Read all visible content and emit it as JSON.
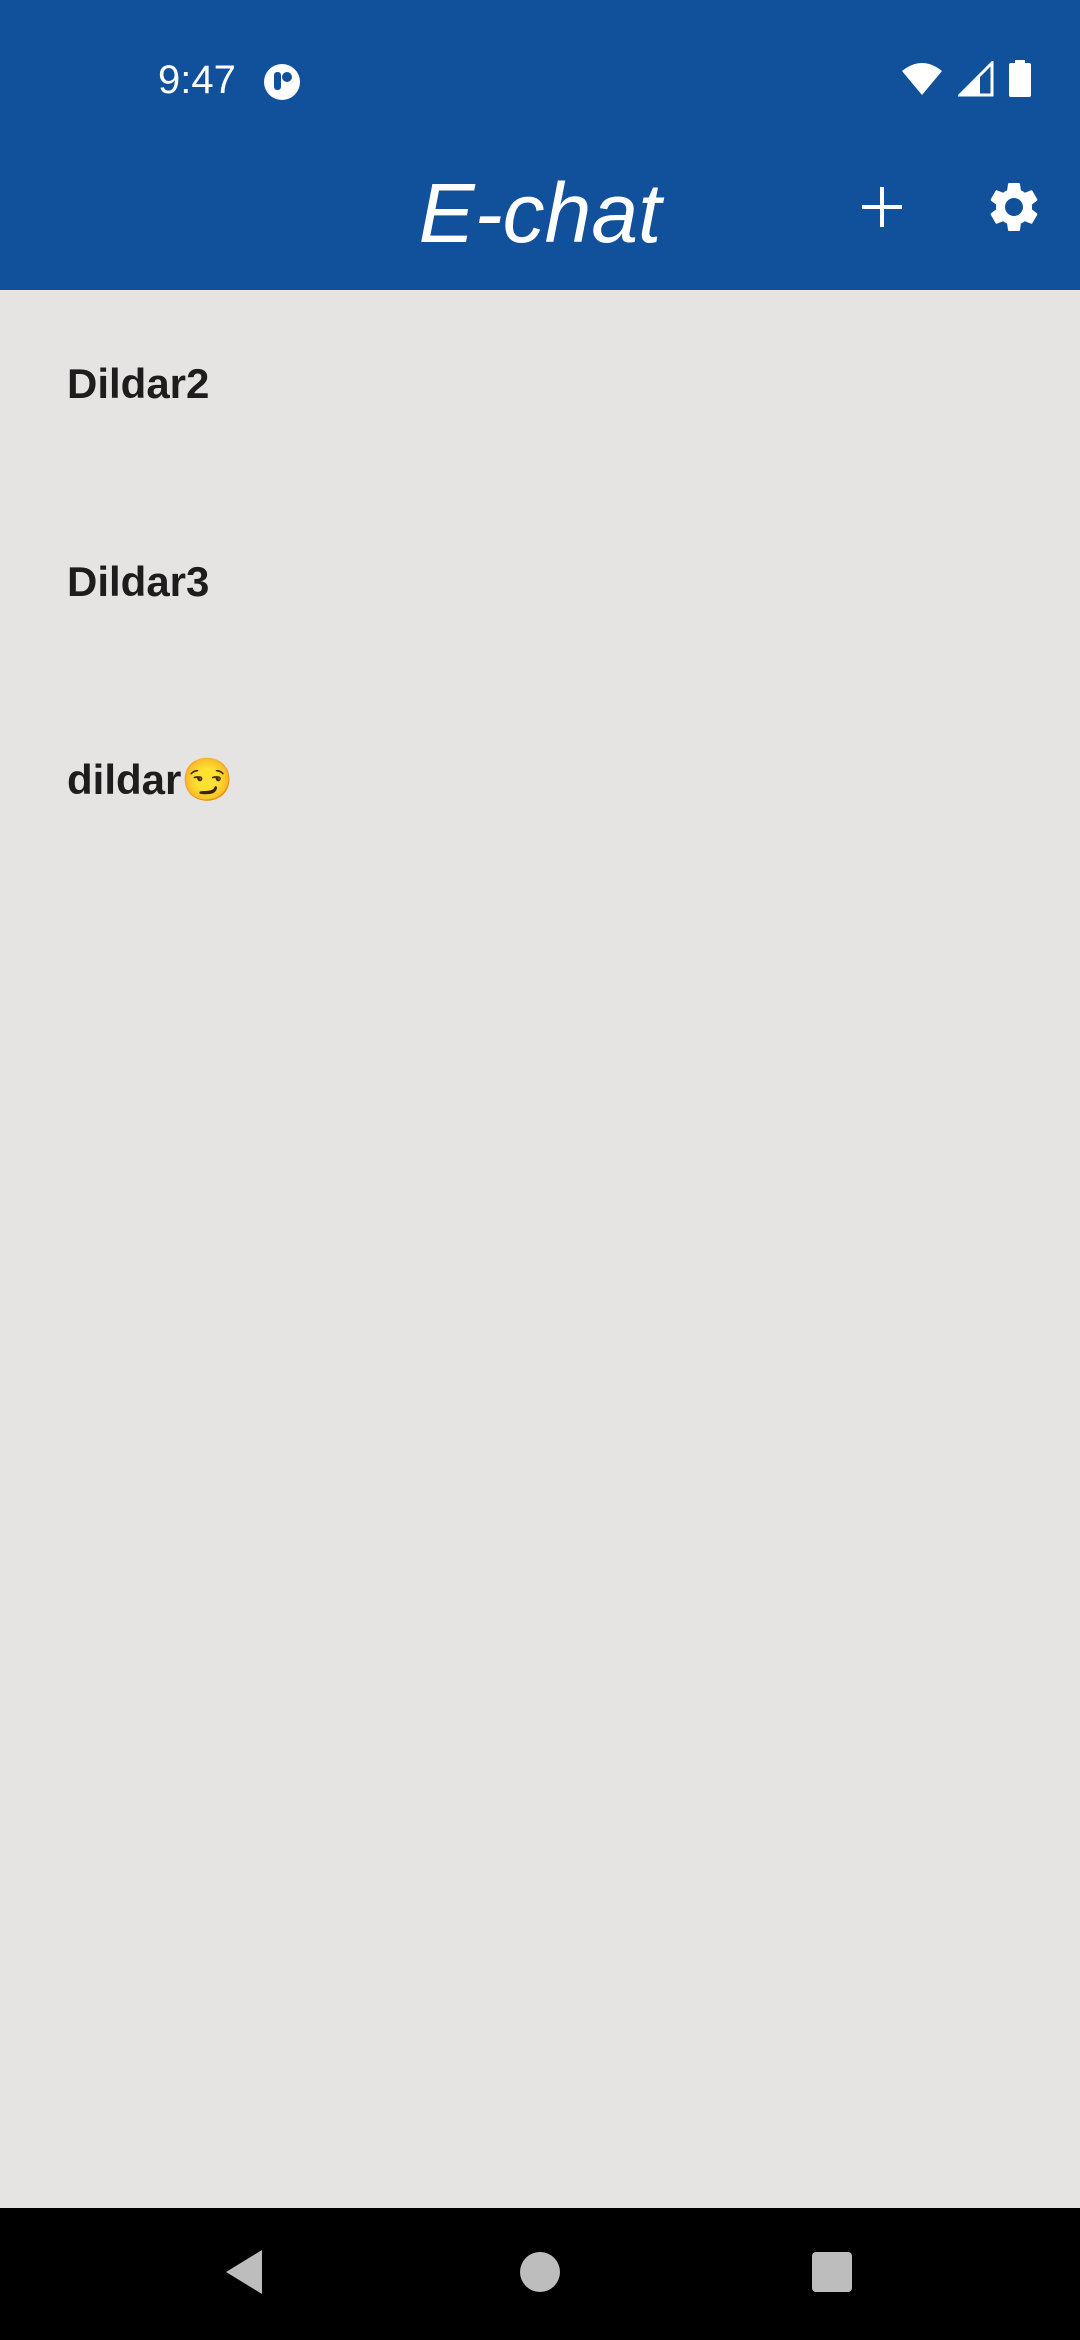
{
  "status_bar": {
    "time": "9:47",
    "icons": [
      "app-notification-icon",
      "wifi-icon",
      "signal-icon",
      "battery-icon"
    ]
  },
  "app_bar": {
    "title": "E-chat",
    "actions": [
      "add-icon",
      "gear-icon"
    ]
  },
  "chats": [
    {
      "label": "Dildar2"
    },
    {
      "label": "Dildar3"
    },
    {
      "label": "dildar😏"
    }
  ],
  "nav_bar": {
    "buttons": [
      "back-icon",
      "home-icon",
      "recents-icon"
    ]
  },
  "colors": {
    "primary": "#11509b",
    "background": "#e6e4e3",
    "text": "#1e1c1d",
    "nav_background": "#000000"
  }
}
